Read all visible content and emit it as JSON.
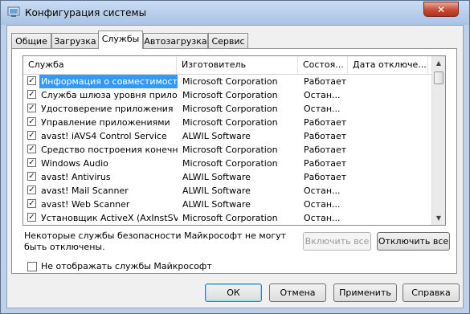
{
  "window": {
    "title": "Конфигурация системы",
    "close_glyph": "✕"
  },
  "tabs": [
    {
      "label": "Общие"
    },
    {
      "label": "Загрузка"
    },
    {
      "label": "Службы"
    },
    {
      "label": "Автозагрузка"
    },
    {
      "label": "Сервис"
    }
  ],
  "services": {
    "columns": [
      "Служба",
      "Изготовитель",
      "Состоя...",
      "Дата отключе..."
    ],
    "rows": [
      {
        "checked": true,
        "name": "Информация о совместимости ...",
        "maker": "Microsoft Corporation",
        "status": "Работает"
      },
      {
        "checked": true,
        "name": "Служба шлюза уровня прилож...",
        "maker": "Microsoft Corporation",
        "status": "Остан..."
      },
      {
        "checked": true,
        "name": "Удостоверение приложения",
        "maker": "Microsoft Corporation",
        "status": "Остан..."
      },
      {
        "checked": true,
        "name": "Управление приложениями",
        "maker": "Microsoft Corporation",
        "status": "Работает"
      },
      {
        "checked": true,
        "name": "avast! iAVS4 Control Service",
        "maker": "ALWIL Software",
        "status": "Работает"
      },
      {
        "checked": true,
        "name": "Средство построения конечн...",
        "maker": "Microsoft Corporation",
        "status": "Работает"
      },
      {
        "checked": true,
        "name": "Windows Audio",
        "maker": "Microsoft Corporation",
        "status": "Работает"
      },
      {
        "checked": true,
        "name": "avast! Antivirus",
        "maker": "ALWIL Software",
        "status": "Работает"
      },
      {
        "checked": true,
        "name": "avast! Mail Scanner",
        "maker": "ALWIL Software",
        "status": "Остан..."
      },
      {
        "checked": true,
        "name": "avast! Web Scanner",
        "maker": "ALWIL Software",
        "status": "Остан..."
      },
      {
        "checked": true,
        "name": "Установщик ActiveX (AxInstSV)",
        "maker": "Microsoft Corporation",
        "status": "Остан..."
      }
    ],
    "check_glyph": "✓",
    "scroll_up_glyph": "▲",
    "scroll_down_glyph": "▼"
  },
  "note": "Некоторые службы безопасности Майкрософт не могут быть отключены.",
  "enable_all_label": "Включить все",
  "disable_all_label": "Отключить все",
  "hide_ms_label": "Не отображать службы Майкрософт",
  "buttons": {
    "ok": "ОК",
    "cancel": "Отмена",
    "apply": "Применить",
    "help": "Справка"
  }
}
